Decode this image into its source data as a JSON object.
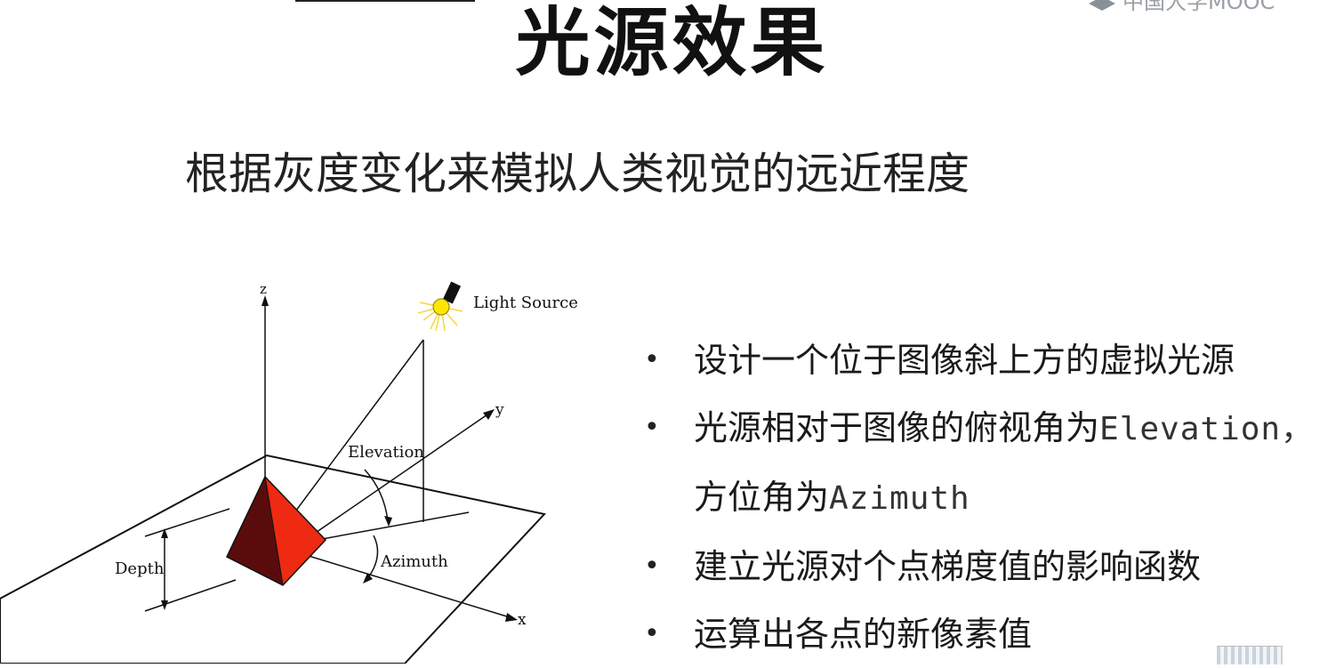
{
  "slide": {
    "title": "光源效果",
    "subtitle": "根据灰度变化来模拟人类视觉的远近程度"
  },
  "logo": {
    "text": "中国大学MOOC"
  },
  "diagram": {
    "labels": {
      "z": "z",
      "y": "y",
      "x": "x",
      "light_source": "Light Source",
      "elevation": "Elevation",
      "azimuth": "Azimuth",
      "depth": "Depth"
    },
    "colors": {
      "pyramid_front": "#ee2a12",
      "pyramid_side": "#5a0c0c",
      "bulb": "#ffe600",
      "rays": "#f5d742"
    }
  },
  "bullets": [
    {
      "text": "设计一个位于图像斜上方的虚拟光源"
    },
    {
      "text": "光源相对于图像的俯视角为",
      "code": "Elevation，"
    },
    {
      "text": "方位角为",
      "code": "Azimuth"
    },
    {
      "text": "建立光源对个点梯度值的影响函数"
    },
    {
      "text": "运算出各点的新像素值"
    }
  ],
  "bullet_symbol": "•"
}
